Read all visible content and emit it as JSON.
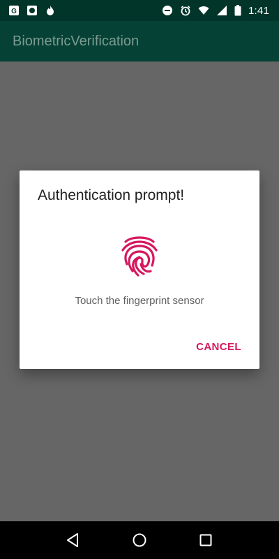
{
  "status_bar": {
    "left_icons": [
      "g-app-icon",
      "record-icon",
      "flame-icon"
    ],
    "right_icons": [
      "do-not-disturb-icon",
      "alarm-icon",
      "wifi-icon",
      "signal-icon",
      "battery-icon"
    ],
    "time": "1:41"
  },
  "app_bar": {
    "title": "BiometricVerification"
  },
  "dialog": {
    "title": "Authentication prompt!",
    "icon": "fingerprint-icon",
    "message": "Touch the fingerprint sensor",
    "cancel_label": "CANCEL",
    "accent_color": "#d6185e"
  },
  "nav_bar": {
    "icons": [
      "back-icon",
      "home-icon",
      "recents-icon"
    ]
  },
  "colors": {
    "status_bar": "#02352a",
    "app_bar": "#054235",
    "scrim_background": "#666666"
  }
}
